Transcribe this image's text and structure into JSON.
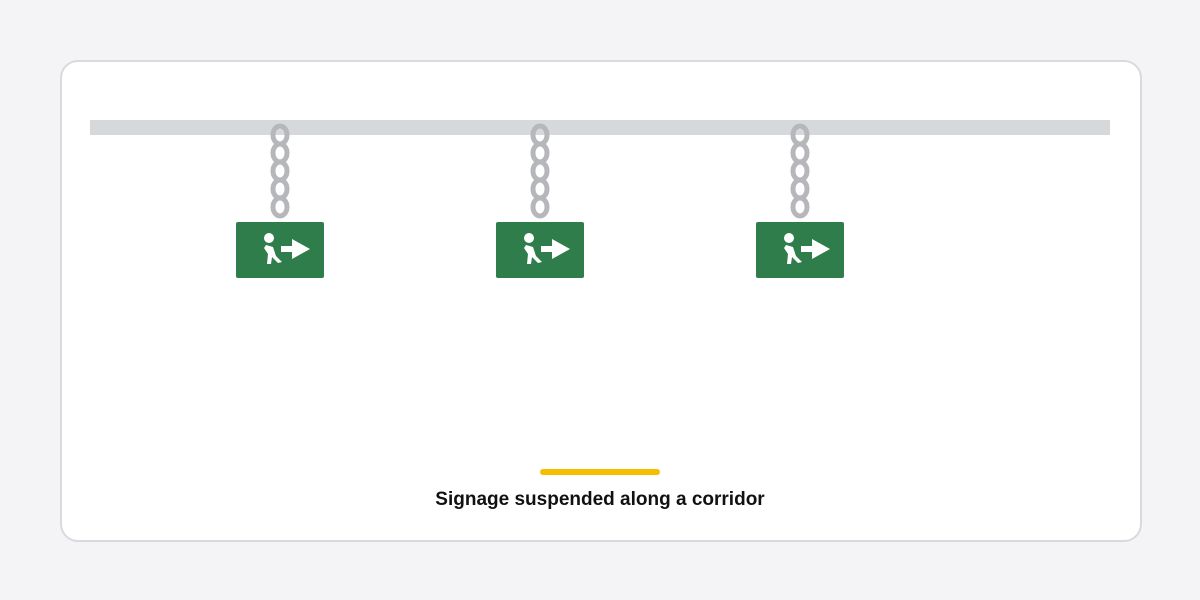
{
  "caption": "Signage suspended along a corridor",
  "colors": {
    "background": "#f4f4f6",
    "card": "#ffffff",
    "rail": "#d6d8db",
    "chain": "#b5b7bb",
    "sign": "#2e7d4b",
    "sign_glyph": "#ffffff",
    "accent": "#f5bf00"
  },
  "signs": [
    {
      "icon": "exit-arrow-icon"
    },
    {
      "icon": "exit-arrow-icon"
    },
    {
      "icon": "exit-arrow-icon"
    }
  ]
}
